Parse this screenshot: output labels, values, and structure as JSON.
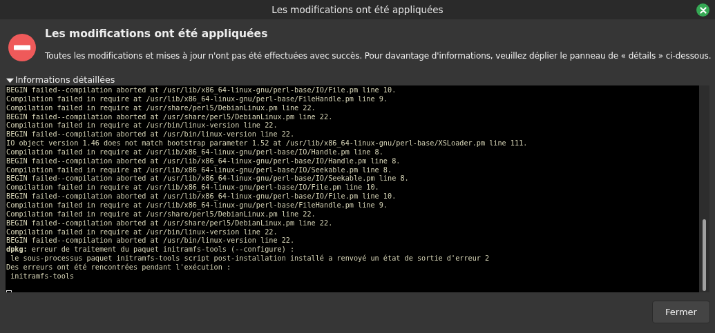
{
  "window": {
    "title": "Les modifications ont été appliquées"
  },
  "heading": "Les modifications ont été appliquées",
  "message": "Toutes les modifications et mises à jour n'ont pas été effectuées avec succès. Pour davantage d'informations, veuillez déplier le panneau de « détails » ci-dessous.",
  "details": {
    "label": "Informations détaillées",
    "expanded": true,
    "lines": [
      "BEGIN failed--compilation aborted at /usr/lib/x86_64-linux-gnu/perl-base/IO/File.pm line 10.",
      "Compilation failed in require at /usr/lib/x86_64-linux-gnu/perl-base/FileHandle.pm line 9.",
      "Compilation failed in require at /usr/share/perl5/DebianLinux.pm line 22.",
      "BEGIN failed--compilation aborted at /usr/share/perl5/DebianLinux.pm line 22.",
      "Compilation failed in require at /usr/bin/linux-version line 22.",
      "BEGIN failed--compilation aborted at /usr/bin/linux-version line 22.",
      "IO object version 1.46 does not match bootstrap parameter 1.52 at /usr/lib/x86_64-linux-gnu/perl-base/XSLoader.pm line 111.",
      "Compilation failed in require at /usr/lib/x86_64-linux-gnu/perl-base/IO/Handle.pm line 8.",
      "BEGIN failed--compilation aborted at /usr/lib/x86_64-linux-gnu/perl-base/IO/Handle.pm line 8.",
      "Compilation failed in require at /usr/lib/x86_64-linux-gnu/perl-base/IO/Seekable.pm line 8.",
      "BEGIN failed--compilation aborted at /usr/lib/x86_64-linux-gnu/perl-base/IO/Seekable.pm line 8.",
      "Compilation failed in require at /usr/lib/x86_64-linux-gnu/perl-base/IO/File.pm line 10.",
      "BEGIN failed--compilation aborted at /usr/lib/x86_64-linux-gnu/perl-base/IO/File.pm line 10.",
      "Compilation failed in require at /usr/lib/x86_64-linux-gnu/perl-base/FileHandle.pm line 9.",
      "Compilation failed in require at /usr/share/perl5/DebianLinux.pm line 22.",
      "BEGIN failed--compilation aborted at /usr/share/perl5/DebianLinux.pm line 22.",
      "Compilation failed in require at /usr/bin/linux-version line 22.",
      "BEGIN failed--compilation aborted at /usr/bin/linux-version line 22.",
      "**dpkg:** erreur de traitement du paquet initramfs-tools (--configure) :",
      " le sous-processus paquet initramfs-tools script post-installation installé a renvoyé un état de sortie d'erreur 2",
      "Des erreurs ont été rencontrées pendant l'exécution :",
      " initramfs-tools"
    ]
  },
  "buttons": [
    "Fermer"
  ]
}
